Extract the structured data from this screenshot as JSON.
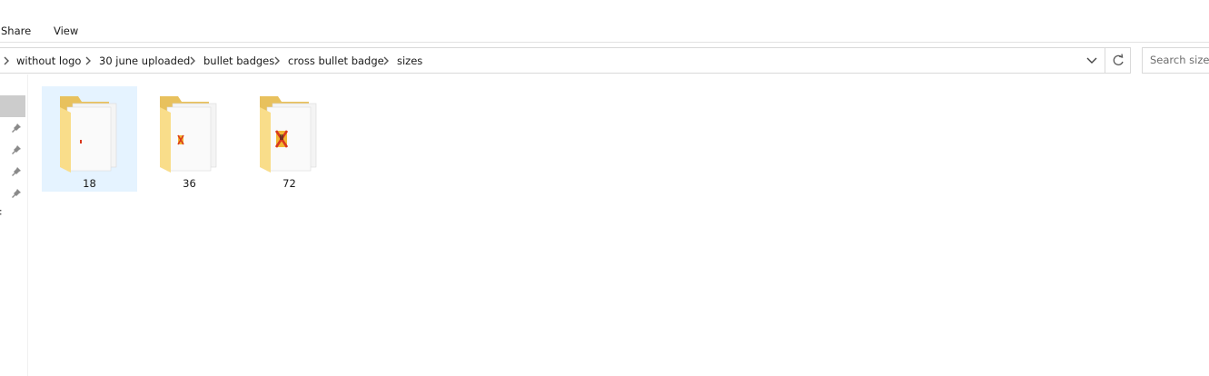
{
  "ribbon": {
    "tabs": [
      {
        "label": "Share"
      },
      {
        "label": "View"
      }
    ]
  },
  "address_bar": {
    "breadcrumbs": [
      {
        "label": "without logo"
      },
      {
        "label": "30 june uploaded"
      },
      {
        "label": "bullet badges"
      },
      {
        "label": "cross bullet badge"
      },
      {
        "label": "sizes"
      }
    ]
  },
  "search": {
    "placeholder": "Search sizes"
  },
  "nav_pane": {
    "pinned_count": 4
  },
  "items": [
    {
      "name": "18",
      "selected": true,
      "thumbnail": "small-red-cross-badge"
    },
    {
      "name": "36",
      "selected": false,
      "thumbnail": "medium-red-cross-badge"
    },
    {
      "name": "72",
      "selected": false,
      "thumbnail": "large-red-cross-badge"
    }
  ],
  "colors": {
    "selection": "#e5f3ff",
    "folder_back": "#e8c15d",
    "folder_front": "#f9dd8a",
    "badge_red": "#d9381e",
    "badge_yellow": "#f2b632"
  }
}
